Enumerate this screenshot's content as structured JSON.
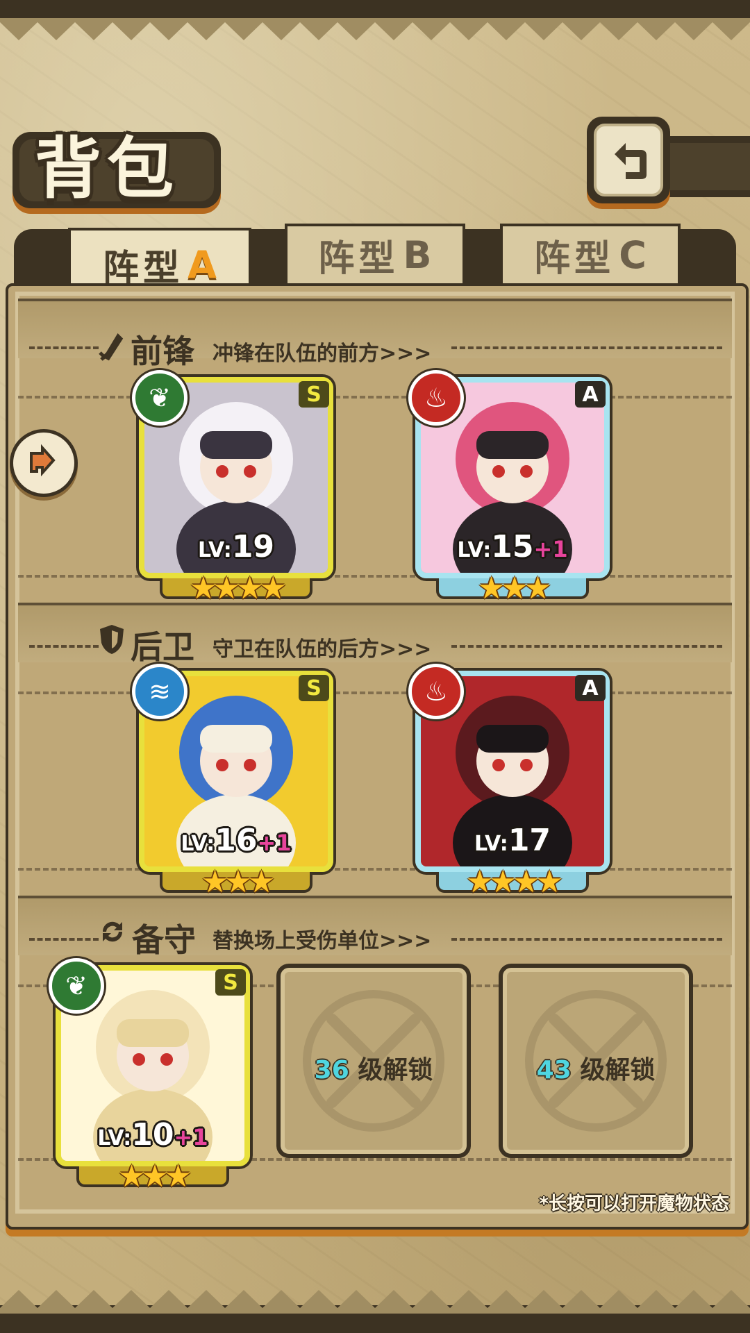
{
  "header": {
    "title": "背包",
    "back_icon": "back-arrow-icon"
  },
  "tabs": [
    {
      "label": "阵型",
      "letter": "A",
      "active": true
    },
    {
      "label": "阵型",
      "letter": "B",
      "active": false
    },
    {
      "label": "阵型",
      "letter": "C",
      "active": false
    }
  ],
  "sections": {
    "front": {
      "icon": "sword-icon",
      "title": "前锋",
      "desc": "冲锋在队伍的前方>>>"
    },
    "rear": {
      "icon": "shield-icon",
      "title": "后卫",
      "desc": "守卫在队伍的后方>>>"
    },
    "reserve": {
      "icon": "swap-icon",
      "title": "备守",
      "desc": "替换场上受伤单位>>>"
    }
  },
  "cards": {
    "front1": {
      "rank": "S",
      "element": "leaf",
      "lv_label": "LV:",
      "lv": "19",
      "plus": "",
      "stars": "★★★★",
      "star_count": 4,
      "palette": [
        "#f4f1f6",
        "#3a3440",
        "#c9c3ce"
      ]
    },
    "front2": {
      "rank": "A",
      "element": "fire",
      "lv_label": "LV:",
      "lv": "15",
      "plus": "+1",
      "stars": "★★★",
      "star_count": 3,
      "palette": [
        "#e0557e",
        "#2b2528",
        "#f6c8de"
      ]
    },
    "rear1": {
      "rank": "S",
      "element": "water",
      "lv_label": "LV:",
      "lv": "16",
      "plus": "+1",
      "stars": "★★★",
      "star_count": 3,
      "palette": [
        "#3f74c9",
        "#f5efe0",
        "#f2cb2e"
      ]
    },
    "rear2": {
      "rank": "A",
      "element": "fire",
      "lv_label": "LV:",
      "lv": "17",
      "plus": "",
      "stars": "★★★★",
      "star_count": 4,
      "palette": [
        "#5b1a1e",
        "#1b1618",
        "#b0272b"
      ]
    },
    "reserve1": {
      "rank": "S",
      "element": "leaf",
      "lv_label": "LV:",
      "lv": "10",
      "plus": "+1",
      "stars": "★★★",
      "star_count": 3,
      "palette": [
        "#f3e3b8",
        "#e8d49c",
        "#fff7d8"
      ]
    }
  },
  "locked": [
    {
      "level": "36",
      "text": "级解锁"
    },
    {
      "level": "43",
      "text": "级解锁"
    }
  ],
  "hint": "*长按可以打开魔物状态",
  "colors": {
    "accent_orange": "#f09a1e",
    "dark_brown": "#3c3222",
    "parchment": "#c9b585",
    "plus_pink": "#e8449c",
    "lock_cyan": "#4fd5e0"
  }
}
